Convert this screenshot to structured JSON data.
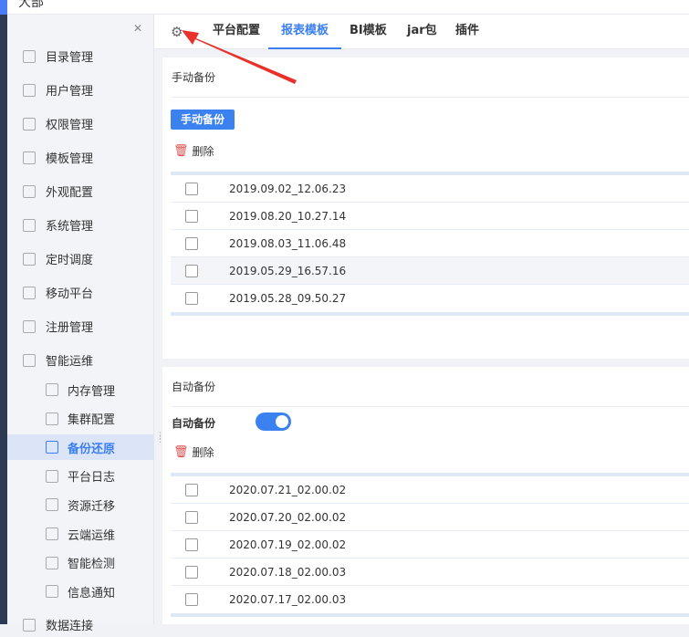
{
  "header": {
    "title": "大部"
  },
  "sidebar": {
    "items": [
      {
        "label": "目录管理",
        "icon": "catalog-icon"
      },
      {
        "label": "用户管理",
        "icon": "user-icon"
      },
      {
        "label": "权限管理",
        "icon": "lock-icon"
      },
      {
        "label": "模板管理",
        "icon": "template-icon"
      },
      {
        "label": "外观配置",
        "icon": "paint-icon"
      },
      {
        "label": "系统管理",
        "icon": "gear-icon"
      },
      {
        "label": "定时调度",
        "icon": "timer-icon"
      },
      {
        "label": "移动平台",
        "icon": "mobile-icon"
      },
      {
        "label": "注册管理",
        "icon": "register-icon"
      },
      {
        "label": "智能运维",
        "icon": "ops-icon"
      }
    ],
    "subitems": [
      {
        "label": "内存管理"
      },
      {
        "label": "集群配置"
      },
      {
        "label": "备份还原",
        "active": true
      },
      {
        "label": "平台日志"
      },
      {
        "label": "资源迁移"
      },
      {
        "label": "云端运维"
      },
      {
        "label": "智能检测"
      },
      {
        "label": "信息通知"
      }
    ],
    "last_item": "数据连接"
  },
  "tabs": [
    {
      "label": "平台配置"
    },
    {
      "label": "报表模板",
      "active": true
    },
    {
      "label": "BI模板"
    },
    {
      "label": "jar包"
    },
    {
      "label": "插件"
    }
  ],
  "manual": {
    "title": "手动备份",
    "button": "手动备份",
    "delete": "删除",
    "rows": [
      "2019.09.02_12.06.23",
      "2019.08.20_10.27.14",
      "2019.08.03_11.06.48",
      "2019.05.29_16.57.16",
      "2019.05.28_09.50.27"
    ]
  },
  "auto": {
    "title": "自动备份",
    "toggle_label": "自动备份",
    "toggle_on": true,
    "delete": "删除",
    "rows": [
      "2020.07.21_02.00.02",
      "2020.07.20_02.00.02",
      "2020.07.19_02.00.02",
      "2020.07.18_02.00.03",
      "2020.07.17_02.00.03"
    ]
  },
  "colors": {
    "accent": "#3b82f0",
    "arrow": "#e8312b"
  }
}
